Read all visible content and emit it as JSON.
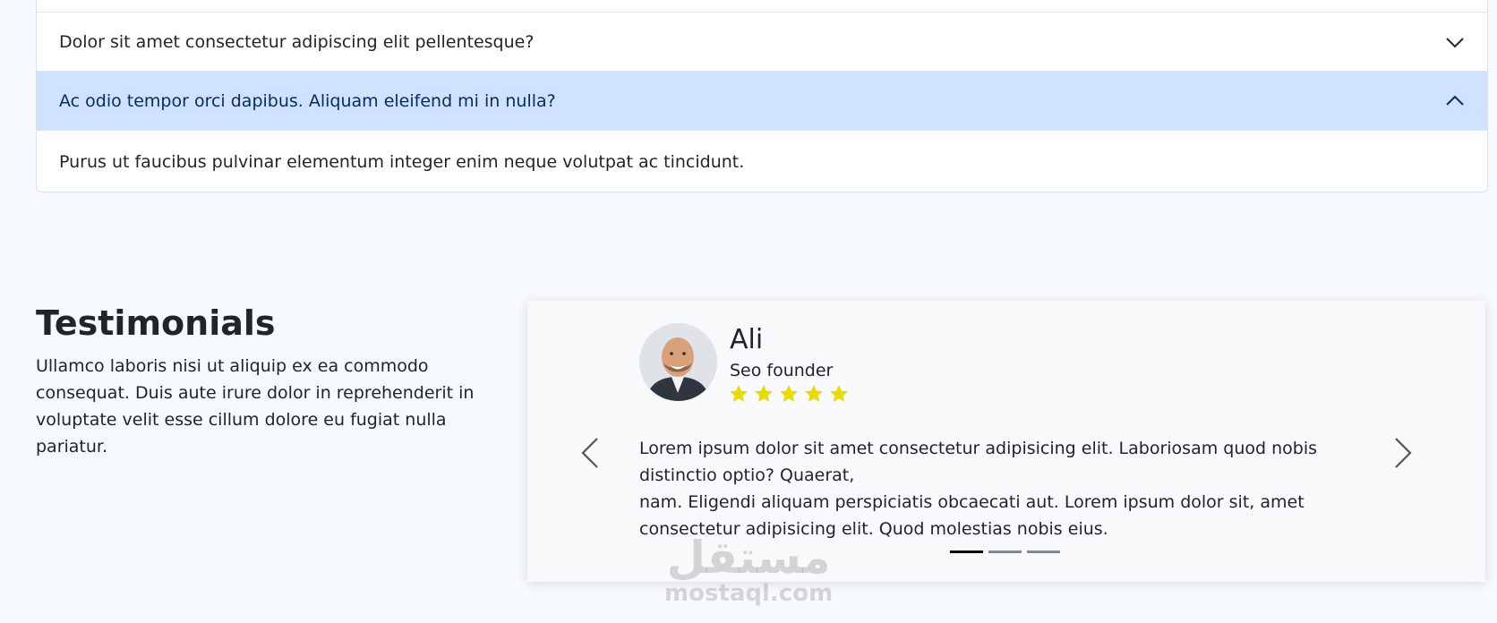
{
  "accordion": {
    "items": [
      {
        "question": "Dolor sit amet consectetur adipiscing elit pellentesque?",
        "expanded": false
      },
      {
        "question": "Ac odio tempor orci dapibus. Aliquam eleifend mi in nulla?",
        "expanded": true,
        "answer": "Purus ut faucibus pulvinar elementum integer enim neque volutpat ac tincidunt."
      }
    ],
    "active_bg": "#cfe2ff"
  },
  "testimonials": {
    "title": "Testimonials",
    "description": "Ullamco laboris nisi ut aliquip ex ea commodo consequat. Duis aute irure dolor in reprehenderit in voluptate velit esse cillum dolore eu fugiat nulla pariatur.",
    "carousel": {
      "name": "Ali",
      "role": "Seo founder",
      "rating": 5,
      "star_color": "#e6dc00",
      "quote_line1": "Lorem ipsum dolor sit amet consectetur adipisicing elit. Laboriosam quod nobis distinctio optio? Quaerat,",
      "quote_line2": "nam. Eligendi aliquam perspiciatis obcaecati aut. Lorem ipsum dolor sit, amet consectetur adipisicing elit. Quod molestias nobis eius.",
      "slides": 3,
      "active_slide": 1,
      "prev_icon": "chevron-left-icon",
      "next_icon": "chevron-right-icon"
    }
  },
  "watermark": {
    "arabic": "مستقل",
    "latin": "mostaql.com"
  }
}
